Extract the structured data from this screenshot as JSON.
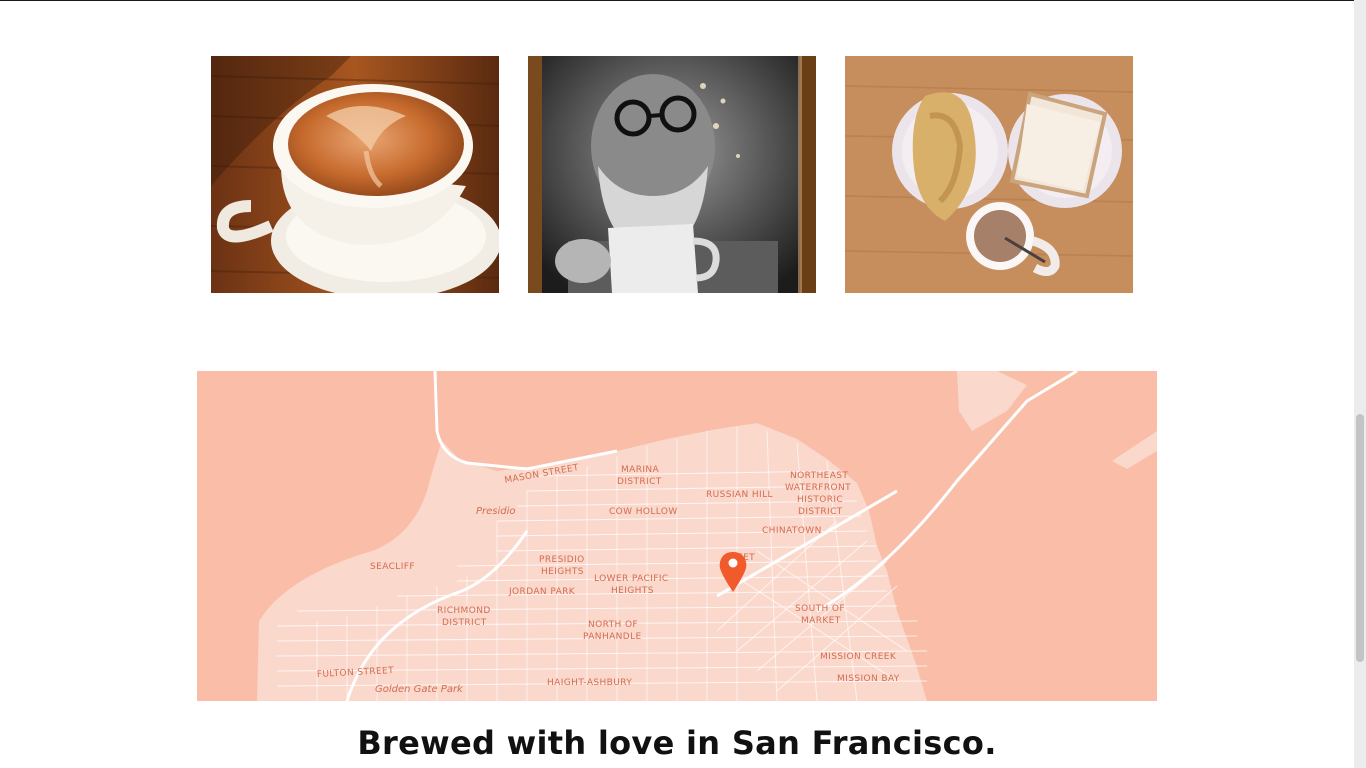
{
  "gallery": {
    "photos": [
      {
        "subject": "latte-art-cup"
      },
      {
        "subject": "bearded-man-with-mug-portrait"
      },
      {
        "subject": "breakfast-with-toast-and-cocoa"
      }
    ]
  },
  "map": {
    "icon": "map-pin-icon",
    "pin_color": "#f15a2b",
    "land_color": "#fbd8cc",
    "water_color": "#f9bda8",
    "labels": {
      "mason_street": "MASON STREET",
      "marina_1": "MARINA",
      "marina_2": "DISTRICT",
      "russian_hill": "RUSSIAN HILL",
      "northeast_1": "NORTHEAST",
      "northeast_2": "WATERFRONT",
      "northeast_3": "HISTORIC",
      "northeast_4": "DISTRICT",
      "presidio": "Presidio",
      "cow_hollow": "COW HOLLOW",
      "chinatown": "CHINATOWN",
      "seacliff": "SEACLIFF",
      "presidio_heights_1": "PRESIDIO",
      "presidio_heights_2": "HEIGHTS",
      "lower_pacific_1": "LOWER PACIFIC",
      "lower_pacific_2": "HEIGHTS",
      "jordan_park": "JORDAN PARK",
      "richmond_1": "RICHMOND",
      "richmond_2": "DISTRICT",
      "north_pan_1": "NORTH OF",
      "north_pan_2": "PANHANDLE",
      "south_market_1": "SOUTH OF",
      "south_market_2": "MARKET",
      "fulton_street": "FULTON STREET",
      "golden_gate_park": "Golden Gate Park",
      "haight_ashbury": "HAIGHT-ASHBURY",
      "mission_creek": "MISSION CREEK",
      "mission_bay": "MISSION BAY",
      "street_fragment": "EET"
    }
  },
  "footer": {
    "headline": "Brewed with love in San Francisco."
  }
}
